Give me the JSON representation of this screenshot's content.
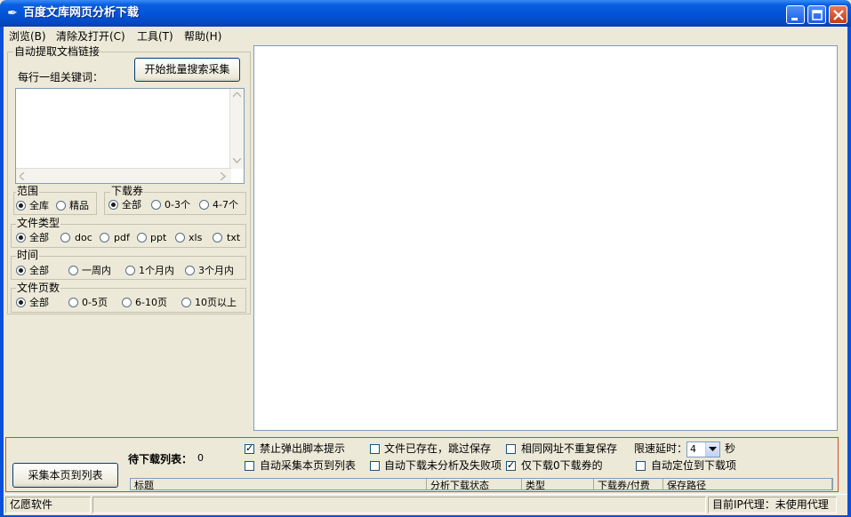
{
  "window": {
    "title": "百度文库网页分析下载",
    "icon": "feather-pen-icon"
  },
  "menu": [
    "浏览(B)",
    "清除及打开(C)",
    "工具(T)",
    "帮助(H)"
  ],
  "left": {
    "group_title": "自动提取文档链接",
    "keywords_label": "每行一组关键词：",
    "batch_button": "开始批量搜索采集",
    "keywords_value": "",
    "range": {
      "legend": "范围",
      "options": [
        "全库",
        "精品"
      ],
      "selected": 0
    },
    "coupon": {
      "legend": "下载券",
      "options": [
        "全部",
        "0-3个",
        "4-7个"
      ],
      "selected": 0
    },
    "filetype": {
      "legend": "文件类型",
      "options": [
        "全部",
        "doc",
        "pdf",
        "ppt",
        "xls",
        "txt"
      ],
      "selected": 0
    },
    "time": {
      "legend": "时间",
      "options": [
        "全部",
        "一周内",
        "1个月内",
        "3个月内"
      ],
      "selected": 0
    },
    "pages": {
      "legend": "文件页数",
      "options": [
        "全部",
        "0-5页",
        "6-10页",
        "10页以上"
      ],
      "selected": 0
    }
  },
  "bottom": {
    "collect_button": "采集本页到列表",
    "pending_label": "待下载列表：",
    "pending_count": "0",
    "checks": {
      "block_script": {
        "label": "禁止弹出脚本提示",
        "checked": true
      },
      "auto_collect": {
        "label": "自动采集本页到列表",
        "checked": false
      },
      "file_exists_skip": {
        "label": "文件已存在，跳过保存",
        "checked": false
      },
      "auto_download": {
        "label": "自动下载未分析及失败项",
        "checked": false
      },
      "same_url_once": {
        "label": "相同网址不重复保存",
        "checked": false
      },
      "only_zero_coupon": {
        "label": "仅下载0下载券的",
        "checked": true
      },
      "auto_locate": {
        "label": "自动定位到下载项",
        "checked": false
      }
    },
    "delay_label": "限速延时：",
    "delay_value": "4",
    "delay_unit": "秒",
    "columns": [
      "标题",
      "分析下载状态",
      "类型",
      "下载券/付费",
      "保存路径"
    ]
  },
  "status": {
    "left": "亿愿软件",
    "right": "目前IP代理：未使用代理"
  }
}
